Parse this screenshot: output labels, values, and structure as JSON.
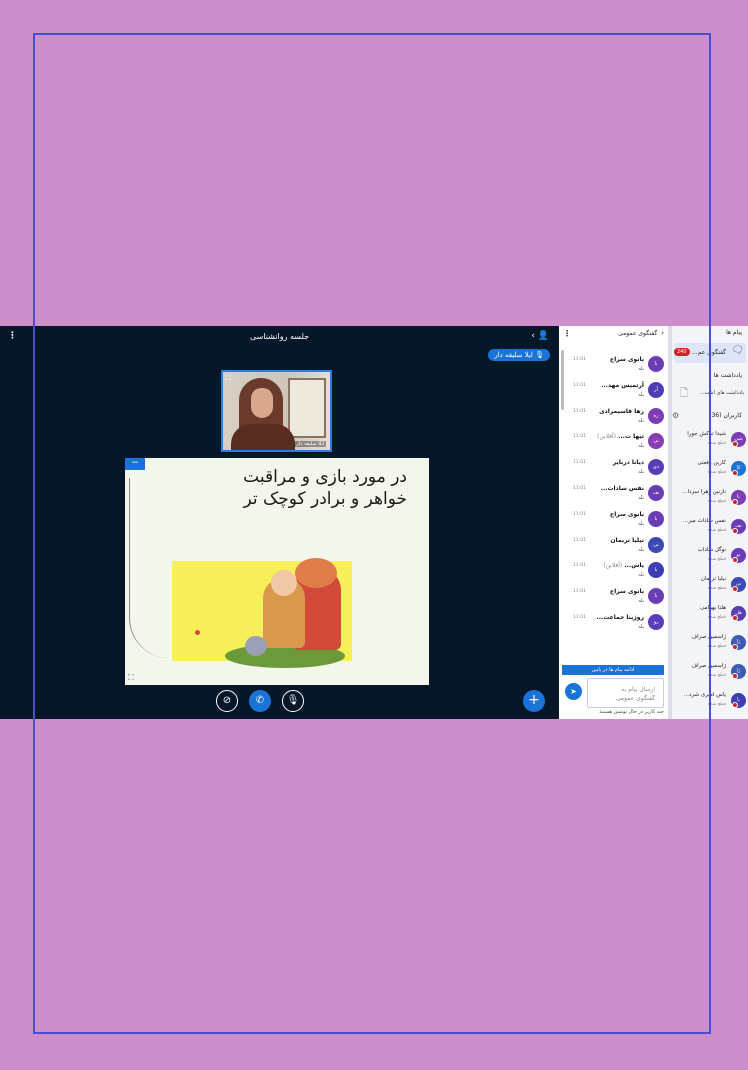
{
  "conference": {
    "title": "جلسه روانشناسی",
    "presenter": "ایلا سلیقه دار",
    "webcam_name": "ایلا سلیقه دار",
    "slide_text_line1": "در مورد بازی و مراقبت",
    "slide_text_line2": "خواهر و برادر کوچک تر",
    "minimize_label": "−",
    "controls": {
      "plus": "+"
    }
  },
  "chat": {
    "title": "گفتگوی عمومی",
    "messages": [
      {
        "initials": "با",
        "name": "بانوی سراج",
        "time": "11:01",
        "text": "بله",
        "color": "#6b3db5",
        "offline": ""
      },
      {
        "initials": "آر",
        "name": "آرتمیس مهد...",
        "time": "11:01",
        "text": "بله",
        "color": "#4a3db5",
        "offline": ""
      },
      {
        "initials": "ره",
        "name": "رها قاسیمرادی",
        "time": "11:01",
        "text": "بله",
        "color": "#7b3db5",
        "offline": ""
      },
      {
        "initials": "تی",
        "name": "تیها ت...",
        "time": "11:01",
        "text": "بله",
        "color": "#8a3db5",
        "offline": "(آفلاین)"
      },
      {
        "initials": "دی",
        "name": "دیانا دربایر",
        "time": "11:01",
        "text": "بله",
        "color": "#5a3db5",
        "offline": ""
      },
      {
        "initials": "نف",
        "name": "نفس سادات...",
        "time": "11:01",
        "text": "بله",
        "color": "#6b3db5",
        "offline": ""
      },
      {
        "initials": "با",
        "name": "بانوی سراج",
        "time": "11:01",
        "text": "بله",
        "color": "#6b3db5",
        "offline": ""
      },
      {
        "initials": "نی",
        "name": "نیلیا تریمان",
        "time": "11:01",
        "text": "بله",
        "color": "#3d4ab5",
        "offline": ""
      },
      {
        "initials": "یا",
        "name": "یاس...",
        "time": "11:01",
        "text": "بله",
        "color": "#3d3db5",
        "offline": "(آفلاین)"
      },
      {
        "initials": "با",
        "name": "بانوی سراج",
        "time": "11:01",
        "text": "بله",
        "color": "#6b3db5",
        "offline": ""
      },
      {
        "initials": "رو",
        "name": "روژینا جماعت...",
        "time": "11:01",
        "text": "بله",
        "color": "#5b3db5",
        "offline": ""
      }
    ],
    "more_messages": "ادامه پیام ها در پایین",
    "input_placeholder_line1": "ارسال پیام به",
    "input_placeholder_line2": "گفتگوی عمومی",
    "typing": "چند کاربر در حال نوشتن هستند"
  },
  "userlist": {
    "messages_title": "پیام ها",
    "public_chat_label": "گفتگوی عم...",
    "unread_count": "240",
    "notes_title": "یادداشت ها",
    "notes_item": "یادداشت های اشت...",
    "users_title": "کاربران (36)",
    "users": [
      {
        "initials": "شی",
        "name": "شیدا ترکش جورا",
        "status": "قطع شده",
        "color": "#7a3db5"
      },
      {
        "initials": "کا",
        "name": "کاربن رفعتی",
        "status": "قطع شده",
        "color": "#1a74d8"
      },
      {
        "initials": "نا",
        "name": "نازنین زهرا سردا...",
        "status": "قطع شده",
        "color": "#7a3db5"
      },
      {
        "initials": "نف",
        "name": "نفس سادات میر...",
        "status": "قطع شده",
        "color": "#6b3db5"
      },
      {
        "initials": "نو",
        "name": "نوگل شاداب",
        "status": "قطع شده",
        "color": "#6b3db5"
      },
      {
        "initials": "نی",
        "name": "نیلیا تریمان",
        "status": "قطع شده",
        "color": "#3d4ab5"
      },
      {
        "initials": "هل",
        "name": "هلنا بهرامی",
        "status": "قطع شده",
        "color": "#5b3db5"
      },
      {
        "initials": "ژا",
        "name": "ژاسمین صراف",
        "status": "قطع شده",
        "color": "#3d5ab5"
      },
      {
        "initials": "ژا",
        "name": "ژاسمین صراف",
        "status": "قطع شده",
        "color": "#3d5ab5"
      },
      {
        "initials": "یا",
        "name": "یاس امیری شرد...",
        "status": "قطع شده",
        "color": "#3d3db5"
      }
    ]
  }
}
